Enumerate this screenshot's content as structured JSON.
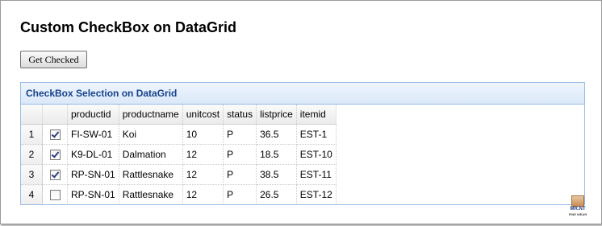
{
  "page": {
    "title": "Custom CheckBox on DataGrid"
  },
  "toolbar": {
    "get_checked_label": "Get Checked"
  },
  "grid": {
    "title": "CheckBox Selection on DataGrid",
    "columns": [
      "productid",
      "productname",
      "unitcost",
      "status",
      "listprice",
      "itemid"
    ],
    "rows": [
      {
        "num": "1",
        "checked": true,
        "cells": [
          "FI-SW-01",
          "Koi",
          "10",
          "P",
          "36.5",
          "EST-1"
        ]
      },
      {
        "num": "2",
        "checked": true,
        "cells": [
          "K9-DL-01",
          "Dalmation",
          "12",
          "P",
          "18.5",
          "EST-10"
        ]
      },
      {
        "num": "3",
        "checked": true,
        "cells": [
          "RP-SN-01",
          "Rattlesnake",
          "12",
          "P",
          "38.5",
          "EST-11"
        ]
      },
      {
        "num": "4",
        "checked": false,
        "cells": [
          "RP-SN-01",
          "Rattlesnake",
          "12",
          "P",
          "26.5",
          "EST-12"
        ]
      }
    ]
  },
  "watermark": {
    "line1": "MR.NT",
    "line2": "FINE WEAR"
  },
  "colors": {
    "grid_border": "#99bbe8",
    "grid_title": "#15428b"
  }
}
